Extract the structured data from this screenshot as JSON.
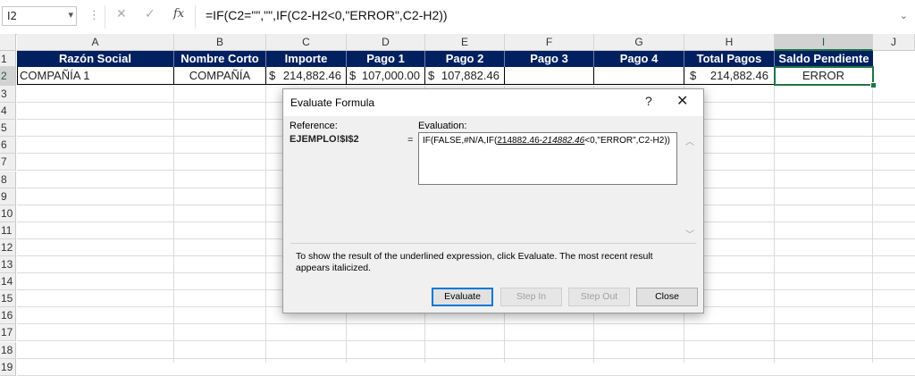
{
  "formula_bar": {
    "name_box": "I2",
    "name_box_dropdown_icon": "chevron-down-icon",
    "separator_icon": "vertical-dots-icon",
    "cancel_icon": "close-icon",
    "enter_icon": "checkmark-icon",
    "fx_label": "fx",
    "formula": "=IF(C2=\"\",\"\",IF(C2-H2<0,\"ERROR\",C2-H2))",
    "expand_icon": "chevron-down-icon"
  },
  "columns": [
    "A",
    "B",
    "C",
    "D",
    "E",
    "F",
    "G",
    "H",
    "I",
    "J"
  ],
  "selected_column": "I",
  "rows": [
    "1",
    "2",
    "3",
    "4",
    "5",
    "6",
    "7",
    "8",
    "9",
    "10",
    "11",
    "12",
    "13",
    "14",
    "15",
    "16",
    "17",
    "18",
    "19"
  ],
  "selected_row": "2",
  "header_row": [
    "Razón Social",
    "Nombre Corto",
    "Importe",
    "Pago 1",
    "Pago 2",
    "Pago 3",
    "Pago 4",
    "Total Pagos",
    "Saldo Pendiente"
  ],
  "data_row": {
    "razon_social": "COMPAÑÍA 1",
    "nombre_corto": "COMPAÑÍA",
    "importe_symbol": "$",
    "importe": "214,882.46",
    "pago1_symbol": "$",
    "pago1": "107,000.00",
    "pago2_symbol": "$",
    "pago2": "107,882.46",
    "pago3": "",
    "pago4": "",
    "total_symbol": "$",
    "total": "214,882.46",
    "saldo": "ERROR"
  },
  "colors": {
    "header_fill": "#002060",
    "selection": "#217346"
  },
  "dialog": {
    "title": "Evaluate Formula",
    "help_label": "?",
    "close_label": "✕",
    "reference_label": "Reference:",
    "reference_value": "EJEMPLO!$I$2",
    "equals": "=",
    "evaluation_label": "Evaluation:",
    "evaluation_prefix": "IF(FALSE,#N/A,IF(",
    "evaluation_underlined_a": "214882.46-",
    "evaluation_underlined_b": "214882.46",
    "evaluation_suffix": "<0,\"ERROR\",C2-H2))",
    "scroll_up_icon": "chevron-up-icon",
    "scroll_down_icon": "chevron-down-icon",
    "hint": "To show the result of the underlined expression, click Evaluate.  The most recent result appears italicized.",
    "buttons": {
      "evaluate": "Evaluate",
      "step_in": "Step In",
      "step_out": "Step Out",
      "close": "Close"
    }
  }
}
